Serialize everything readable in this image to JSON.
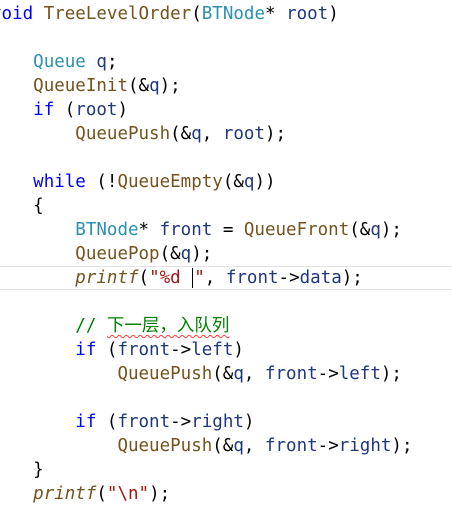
{
  "editor": {
    "current_line": 11,
    "lines": [
      [
        {
          "t": "void",
          "c": "kw"
        },
        {
          "t": " ",
          "c": "pl"
        },
        {
          "t": "TreeLevelOrder",
          "c": "fn"
        },
        {
          "t": "(",
          "c": "pl"
        },
        {
          "t": "BTNode",
          "c": "ty"
        },
        {
          "t": "* ",
          "c": "pl"
        },
        {
          "t": "root",
          "c": "pv"
        },
        {
          "t": ")",
          "c": "pl"
        }
      ],
      [
        {
          "t": "{",
          "c": "pl"
        }
      ],
      [
        {
          "t": "    ",
          "c": "pl"
        },
        {
          "t": "Queue",
          "c": "ty"
        },
        {
          "t": " ",
          "c": "pl"
        },
        {
          "t": "q",
          "c": "pv"
        },
        {
          "t": ";",
          "c": "pl"
        }
      ],
      [
        {
          "t": "    ",
          "c": "pl"
        },
        {
          "t": "QueueInit",
          "c": "fn"
        },
        {
          "t": "(&",
          "c": "pl"
        },
        {
          "t": "q",
          "c": "pv"
        },
        {
          "t": ");",
          "c": "pl"
        }
      ],
      [
        {
          "t": "    ",
          "c": "pl"
        },
        {
          "t": "if",
          "c": "kw"
        },
        {
          "t": " (",
          "c": "pl"
        },
        {
          "t": "root",
          "c": "pv"
        },
        {
          "t": ")",
          "c": "pl"
        }
      ],
      [
        {
          "t": "        ",
          "c": "pl"
        },
        {
          "t": "QueuePush",
          "c": "fn"
        },
        {
          "t": "(&",
          "c": "pl"
        },
        {
          "t": "q",
          "c": "pv"
        },
        {
          "t": ", ",
          "c": "pl"
        },
        {
          "t": "root",
          "c": "pv"
        },
        {
          "t": ");",
          "c": "pl"
        }
      ],
      [],
      [
        {
          "t": "    ",
          "c": "pl"
        },
        {
          "t": "while",
          "c": "kw"
        },
        {
          "t": " (!",
          "c": "pl"
        },
        {
          "t": "QueueEmpty",
          "c": "fn"
        },
        {
          "t": "(&",
          "c": "pl"
        },
        {
          "t": "q",
          "c": "pv"
        },
        {
          "t": "))",
          "c": "pl"
        }
      ],
      [
        {
          "t": "    {",
          "c": "pl"
        }
      ],
      [
        {
          "t": "        ",
          "c": "pl"
        },
        {
          "t": "BTNode",
          "c": "ty"
        },
        {
          "t": "* ",
          "c": "pl"
        },
        {
          "t": "front",
          "c": "pv"
        },
        {
          "t": " = ",
          "c": "pl"
        },
        {
          "t": "QueueFront",
          "c": "fn"
        },
        {
          "t": "(&",
          "c": "pl"
        },
        {
          "t": "q",
          "c": "pv"
        },
        {
          "t": ");",
          "c": "pl"
        }
      ],
      [
        {
          "t": "        ",
          "c": "pl"
        },
        {
          "t": "QueuePop",
          "c": "fn"
        },
        {
          "t": "(&",
          "c": "pl"
        },
        {
          "t": "q",
          "c": "pv"
        },
        {
          "t": ");",
          "c": "pl"
        }
      ],
      [
        {
          "t": "        ",
          "c": "pl"
        },
        {
          "t": "printf",
          "c": "fn-it"
        },
        {
          "t": "(",
          "c": "pl"
        },
        {
          "t": "\"%d ",
          "c": "str"
        },
        {
          "t": "",
          "c": "caret"
        },
        {
          "t": "\"",
          "c": "str"
        },
        {
          "t": ", ",
          "c": "pl"
        },
        {
          "t": "front",
          "c": "pv"
        },
        {
          "t": "->",
          "c": "pl"
        },
        {
          "t": "data",
          "c": "pv"
        },
        {
          "t": ");",
          "c": "pl"
        }
      ],
      [],
      [
        {
          "t": "        ",
          "c": "pl"
        },
        {
          "t": "// ",
          "c": "cm"
        },
        {
          "t": "下一层，入队列",
          "c": "cm squiggle"
        }
      ],
      [
        {
          "t": "        ",
          "c": "pl"
        },
        {
          "t": "if",
          "c": "kw"
        },
        {
          "t": " (",
          "c": "pl"
        },
        {
          "t": "front",
          "c": "pv"
        },
        {
          "t": "->",
          "c": "pl"
        },
        {
          "t": "left",
          "c": "pv"
        },
        {
          "t": ")",
          "c": "pl"
        }
      ],
      [
        {
          "t": "            ",
          "c": "pl"
        },
        {
          "t": "QueuePush",
          "c": "fn"
        },
        {
          "t": "(&",
          "c": "pl"
        },
        {
          "t": "q",
          "c": "pv"
        },
        {
          "t": ", ",
          "c": "pl"
        },
        {
          "t": "front",
          "c": "pv"
        },
        {
          "t": "->",
          "c": "pl"
        },
        {
          "t": "left",
          "c": "pv"
        },
        {
          "t": ");",
          "c": "pl"
        }
      ],
      [],
      [
        {
          "t": "        ",
          "c": "pl"
        },
        {
          "t": "if",
          "c": "kw"
        },
        {
          "t": " (",
          "c": "pl"
        },
        {
          "t": "front",
          "c": "pv"
        },
        {
          "t": "->",
          "c": "pl"
        },
        {
          "t": "right",
          "c": "pv"
        },
        {
          "t": ")",
          "c": "pl"
        }
      ],
      [
        {
          "t": "            ",
          "c": "pl"
        },
        {
          "t": "QueuePush",
          "c": "fn"
        },
        {
          "t": "(&",
          "c": "pl"
        },
        {
          "t": "q",
          "c": "pv"
        },
        {
          "t": ", ",
          "c": "pl"
        },
        {
          "t": "front",
          "c": "pv"
        },
        {
          "t": "->",
          "c": "pl"
        },
        {
          "t": "right",
          "c": "pv"
        },
        {
          "t": ");",
          "c": "pl"
        }
      ],
      [
        {
          "t": "    }",
          "c": "pl"
        }
      ],
      [
        {
          "t": "    ",
          "c": "pl"
        },
        {
          "t": "printf",
          "c": "fn-it"
        },
        {
          "t": "(",
          "c": "pl"
        },
        {
          "t": "\"\\n\"",
          "c": "str"
        },
        {
          "t": ");",
          "c": "pl"
        }
      ]
    ]
  }
}
